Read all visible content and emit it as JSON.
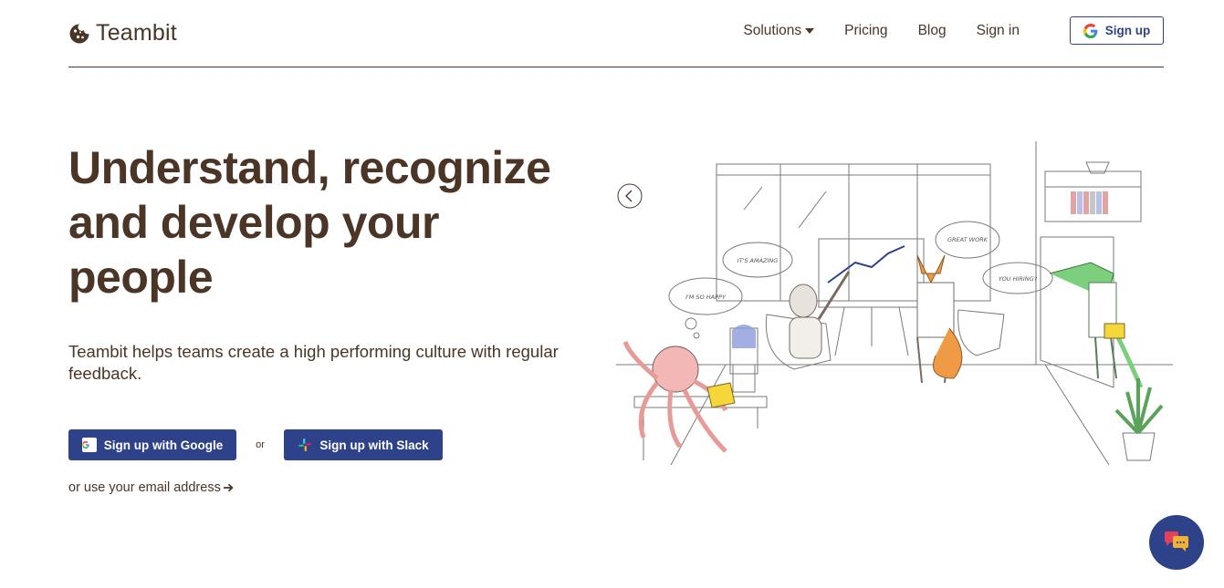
{
  "brand": {
    "name": "Teambit",
    "logo_icon": "cookie-icon",
    "text_color": "#4a3526",
    "accent": "#2d4289"
  },
  "nav": {
    "items": [
      {
        "label": "Solutions",
        "has_dropdown": true
      },
      {
        "label": "Pricing"
      },
      {
        "label": "Blog"
      },
      {
        "label": "Sign in"
      }
    ],
    "signup_label": "Sign up"
  },
  "hero": {
    "headline": "Understand, recognize and develop your people",
    "lead": "Teambit helps teams create a high performing culture with regular feedback.",
    "google_cta": "Sign up with Google",
    "or_text": "or",
    "slack_cta": "Sign up with Slack",
    "email_link": "or use your email address"
  },
  "illustration": {
    "bubbles": [
      "I'M SO HAPPY",
      "IT'S AMAZING",
      "GREAT WORK",
      "YOU HIRING?"
    ]
  },
  "chat_widget": {
    "icon": "chat-icon"
  }
}
